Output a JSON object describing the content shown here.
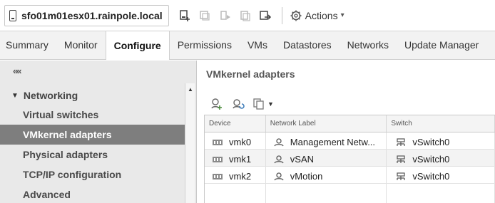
{
  "header": {
    "host_name": "sfo01m01esx01.rainpole.local",
    "actions_label": "Actions"
  },
  "tabs": [
    "Summary",
    "Monitor",
    "Configure",
    "Permissions",
    "VMs",
    "Datastores",
    "Networks",
    "Update Manager"
  ],
  "active_tab": "Configure",
  "sidebar": {
    "collapse_glyph": "««",
    "group_label": "Networking",
    "items": [
      {
        "label": "Virtual switches"
      },
      {
        "label": "VMkernel adapters",
        "selected": true
      },
      {
        "label": "Physical adapters"
      },
      {
        "label": "TCP/IP configuration"
      },
      {
        "label": "Advanced"
      }
    ]
  },
  "main": {
    "section_title": "VMkernel adapters",
    "columns": [
      "Device",
      "Network Label",
      "Switch"
    ],
    "rows": [
      {
        "device": "vmk0",
        "label": "Management Netw...",
        "switch": "vSwitch0"
      },
      {
        "device": "vmk1",
        "label": "vSAN",
        "switch": "vSwitch0"
      },
      {
        "device": "vmk2",
        "label": "vMotion",
        "switch": "vSwitch0"
      }
    ]
  },
  "icons": {
    "host": "host-icon",
    "add_host_networking": "add-networking-icon",
    "refresh": "refresh-icon",
    "copy": "copy-icon",
    "nic": "nic-icon",
    "network": "network-icon",
    "switch": "switch-icon"
  }
}
